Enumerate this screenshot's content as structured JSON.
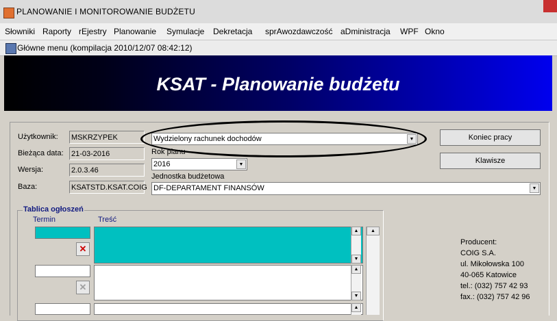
{
  "window": {
    "title": "PLANOWANIE I MONITOROWANIE BUDŻETU"
  },
  "menu": [
    "Słowniki",
    "Raporty",
    "rEjestry",
    "Planowanie",
    "Symulacje",
    "Dekretacja",
    "sprAwozdawczość",
    "aDministracja",
    "WPF",
    "Okno"
  ],
  "subtitle": "Główne menu (kompilacja 2010/12/07 08:42:12)",
  "banner": {
    "title": "KSAT - Planowanie budżetu"
  },
  "form": {
    "user_label": "Użytkownik:",
    "user_value": "MSKRZYPEK",
    "date_label": "Bieżąca data:",
    "date_value": "21-03-2016",
    "version_label": "Wersja:",
    "version_value": "2.0.3.46",
    "db_label": "Baza:",
    "db_value": "KSATSTD.KSAT.COIG",
    "account_value": "Wydzielony rachunek dochodów",
    "year_label": "Rok planu",
    "year_value": "2016",
    "unit_label": "Jednostka budżetowa",
    "unit_value": "DF-DEPARTAMENT FINANSÓW"
  },
  "buttons": {
    "exit": "Koniec pracy",
    "keys": "Klawisze"
  },
  "board": {
    "title": "Tablica ogłoszeń",
    "col_term": "Termin",
    "col_content": "Treść"
  },
  "producer": {
    "label": "Producent:",
    "lines": [
      "COIG S.A.",
      "ul. Mikołowska 100",
      "40-065 Katowice",
      "tel.: (032) 757 42 93",
      "fax.: (032) 757 42 96"
    ]
  },
  "colors": {
    "banner_start": "#000000",
    "banner_end": "#0000ee",
    "selected_row": "#00c0c0",
    "delete_icon": "#cc0000"
  },
  "icons": {
    "app": "java-cup-icon",
    "menu": "form-icon",
    "delete": "delete-x-icon",
    "dropdown": "chevron-down-icon"
  }
}
